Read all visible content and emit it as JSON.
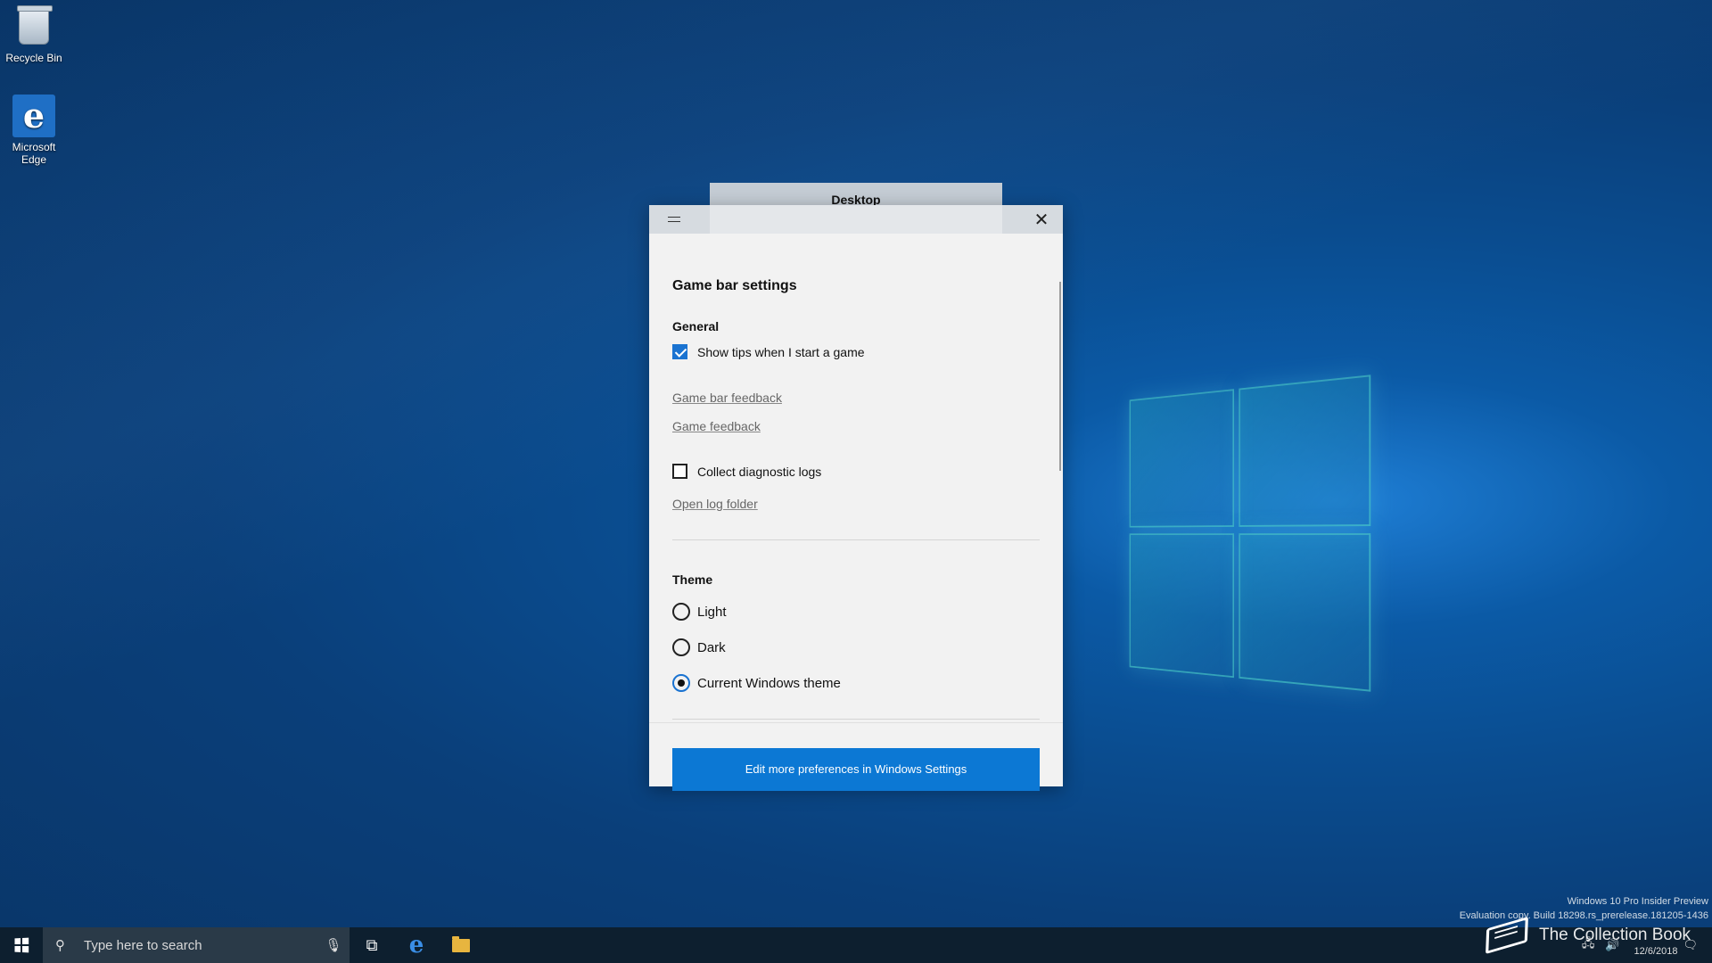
{
  "desktop": {
    "icons": [
      {
        "label": "Recycle Bin",
        "icon": "recycle-bin-icon"
      },
      {
        "label": "Microsoft Edge",
        "icon": "edge-icon"
      }
    ],
    "overlay_label": "Desktop"
  },
  "window": {
    "menu_icon": "hamburger-icon",
    "close_icon": "close-icon",
    "title": "Game bar settings",
    "general": {
      "heading": "General",
      "show_tips_label": "Show tips when I start a game",
      "show_tips_checked": true,
      "links": [
        "Game bar feedback",
        "Game feedback"
      ],
      "collect_logs_label": "Collect diagnostic logs",
      "collect_logs_checked": false,
      "open_log_folder": "Open log folder"
    },
    "theme": {
      "heading": "Theme",
      "options": [
        "Light",
        "Dark",
        "Current Windows theme"
      ],
      "selected": "Current Windows theme"
    },
    "footer_button": "Edit more preferences in Windows Settings",
    "accent_color": "#0c78d4"
  },
  "taskbar": {
    "search_placeholder": "Type here to search",
    "pinned": [
      "task-view-icon",
      "edge-icon",
      "file-explorer-icon"
    ]
  },
  "watermark": {
    "line1": "Windows 10 Pro Insider Preview",
    "line2": "Evaluation copy. Build 18298.rs_prerelease.181205-1436"
  },
  "tray": {
    "date": "12/6/2018"
  },
  "brand": "The Collection Book"
}
